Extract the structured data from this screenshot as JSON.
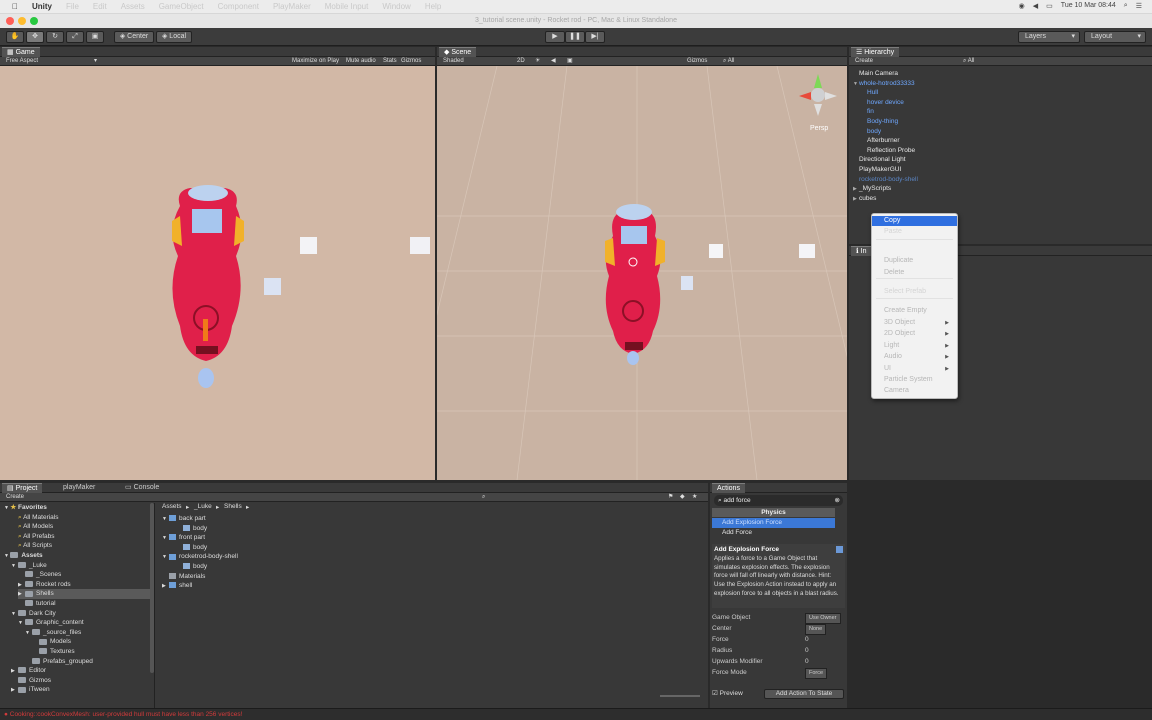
{
  "menubar": {
    "app": "Unity",
    "items": [
      "File",
      "Edit",
      "Assets",
      "GameObject",
      "Component",
      "PlayMaker",
      "Mobile Input",
      "Window",
      "Help"
    ],
    "clock": "Tue 10 Mar  08:44"
  },
  "window_title": "3_tutorial scene.unity - Rocket rod - PC, Mac & Linux Standalone",
  "toolbar": {
    "pivot": "Center",
    "space": "Local",
    "layers": "Layers",
    "layout": "Layout"
  },
  "game": {
    "tab": "Game",
    "aspect": "Free Aspect",
    "maximize": "Maximize on Play",
    "mute": "Mute audio",
    "stats": "Stats",
    "gizmos": "Gizmos"
  },
  "scene": {
    "tab": "Scene",
    "shading": "Shaded",
    "mode2d": "2D",
    "gizmos": "Gizmos",
    "search": "All",
    "persp": "Persp"
  },
  "hierarchy": {
    "tab": "Hierarchy",
    "create": "Create",
    "search": "All",
    "items": [
      {
        "label": "Main Camera",
        "indent": 0,
        "color": "#e8e8e8",
        "arrow": ""
      },
      {
        "label": "whole-hotrod33333",
        "indent": 0,
        "color": "#6fa8ff",
        "arrow": "▼"
      },
      {
        "label": "Hull",
        "indent": 1,
        "color": "#6fa8ff",
        "arrow": ""
      },
      {
        "label": "hover device",
        "indent": 1,
        "color": "#6fa8ff",
        "arrow": ""
      },
      {
        "label": "fin",
        "indent": 1,
        "color": "#6fa8ff",
        "arrow": ""
      },
      {
        "label": "Body-thing",
        "indent": 1,
        "color": "#6fa8ff",
        "arrow": ""
      },
      {
        "label": "body",
        "indent": 1,
        "color": "#6fa8ff",
        "arrow": ""
      },
      {
        "label": "Afterburner",
        "indent": 1,
        "color": "#e8e8e8",
        "arrow": ""
      },
      {
        "label": "Reflection Probe",
        "indent": 1,
        "color": "#e8e8e8",
        "arrow": ""
      },
      {
        "label": "Directional Light",
        "indent": 0,
        "color": "#e8e8e8",
        "arrow": ""
      },
      {
        "label": "PlayMakerGUI",
        "indent": 0,
        "color": "#e8e8e8",
        "arrow": ""
      },
      {
        "label": "rocketrod-body-shell",
        "indent": 0,
        "color": "#5b85c4",
        "arrow": ""
      },
      {
        "label": "_MyScripts",
        "indent": 0,
        "color": "#e8e8e8",
        "arrow": "▶"
      },
      {
        "label": "cubes",
        "indent": 0,
        "color": "#e8e8e8",
        "arrow": "▶"
      }
    ]
  },
  "context_menu": {
    "items": [
      {
        "label": "Copy",
        "state": "selected",
        "sub": false
      },
      {
        "label": "Paste",
        "state": "disabled",
        "sub": false
      },
      {
        "label": "Duplicate",
        "state": "normal",
        "sub": false
      },
      {
        "label": "Delete",
        "state": "normal",
        "sub": false
      },
      {
        "label": "Select Prefab",
        "state": "disabled",
        "sub": false
      },
      {
        "label": "Create Empty",
        "state": "normal",
        "sub": false
      },
      {
        "label": "3D Object",
        "state": "normal",
        "sub": true
      },
      {
        "label": "2D Object",
        "state": "normal",
        "sub": true
      },
      {
        "label": "Light",
        "state": "normal",
        "sub": true
      },
      {
        "label": "Audio",
        "state": "normal",
        "sub": true
      },
      {
        "label": "UI",
        "state": "normal",
        "sub": true
      },
      {
        "label": "Particle System",
        "state": "normal",
        "sub": false
      },
      {
        "label": "Camera",
        "state": "normal",
        "sub": false
      }
    ]
  },
  "inspector": {
    "tab": "In"
  },
  "project": {
    "tabs": [
      "Project",
      "playMaker",
      "Console"
    ],
    "create": "Create",
    "favorites_label": "Favorites",
    "favorites": [
      "All Materials",
      "All Models",
      "All Prefabs",
      "All Scripts"
    ],
    "assets_label": "Assets",
    "tree": [
      {
        "label": "_Luke",
        "indent": 1,
        "arrow": "▼"
      },
      {
        "label": "_Scenes",
        "indent": 2,
        "arrow": ""
      },
      {
        "label": "Rocket rods",
        "indent": 2,
        "arrow": "▶"
      },
      {
        "label": "Shells",
        "indent": 2,
        "arrow": "▶",
        "selected": true
      },
      {
        "label": "tutorial",
        "indent": 2,
        "arrow": ""
      },
      {
        "label": "Dark City",
        "indent": 1,
        "arrow": "▼"
      },
      {
        "label": "Graphic_content",
        "indent": 2,
        "arrow": "▼"
      },
      {
        "label": "_source_files",
        "indent": 3,
        "arrow": "▼"
      },
      {
        "label": "Models",
        "indent": 4,
        "arrow": ""
      },
      {
        "label": "Textures",
        "indent": 4,
        "arrow": ""
      },
      {
        "label": "Prefabs_grouped",
        "indent": 3,
        "arrow": ""
      },
      {
        "label": "Editor",
        "indent": 1,
        "arrow": "▶"
      },
      {
        "label": "Gizmos",
        "indent": 1,
        "arrow": ""
      },
      {
        "label": "iTween",
        "indent": 1,
        "arrow": "▶"
      }
    ],
    "breadcrumb": [
      "Assets",
      "_Luke",
      "Shells"
    ],
    "files": [
      {
        "label": "back part",
        "indent": 0,
        "arrow": "▼",
        "kind": "model"
      },
      {
        "label": "body",
        "indent": 1,
        "arrow": "",
        "kind": "mesh"
      },
      {
        "label": "front part",
        "indent": 0,
        "arrow": "▼",
        "kind": "model"
      },
      {
        "label": "body",
        "indent": 1,
        "arrow": "",
        "kind": "mesh"
      },
      {
        "label": "rocketrod-body-shell",
        "indent": 0,
        "arrow": "▼",
        "kind": "model"
      },
      {
        "label": "body",
        "indent": 1,
        "arrow": "",
        "kind": "mesh"
      },
      {
        "label": "Materials",
        "indent": 0,
        "arrow": "",
        "kind": "folder"
      },
      {
        "label": "shell",
        "indent": 0,
        "arrow": "▶",
        "kind": "model"
      }
    ]
  },
  "actions": {
    "tab": "Actions",
    "search": "add force",
    "category": "Physics",
    "list": [
      {
        "label": "Add Explosion Force",
        "selected": true
      },
      {
        "label": "Add Force",
        "selected": false
      }
    ],
    "detail_title": "Add Explosion Force",
    "description": "Applies a force to a Game Object that simulates explosion effects. The explosion force will fall off linearly with distance. Hint: Use the Explosion Action instead to apply an explosion force to all objects in a blast radius.",
    "props": [
      {
        "label": "Game Object",
        "value": "Use Owner"
      },
      {
        "label": "Center",
        "value": "None"
      },
      {
        "label": "Force",
        "value": "0"
      },
      {
        "label": "Radius",
        "value": "0"
      },
      {
        "label": "Upwards Modifier",
        "value": "0"
      },
      {
        "label": "Force Mode",
        "value": "Force"
      }
    ],
    "preview": "Preview",
    "add_button": "Add Action To State"
  },
  "status": "Cooking::cookConvexMesh: user-provided hull must have less than 256 vertices!"
}
